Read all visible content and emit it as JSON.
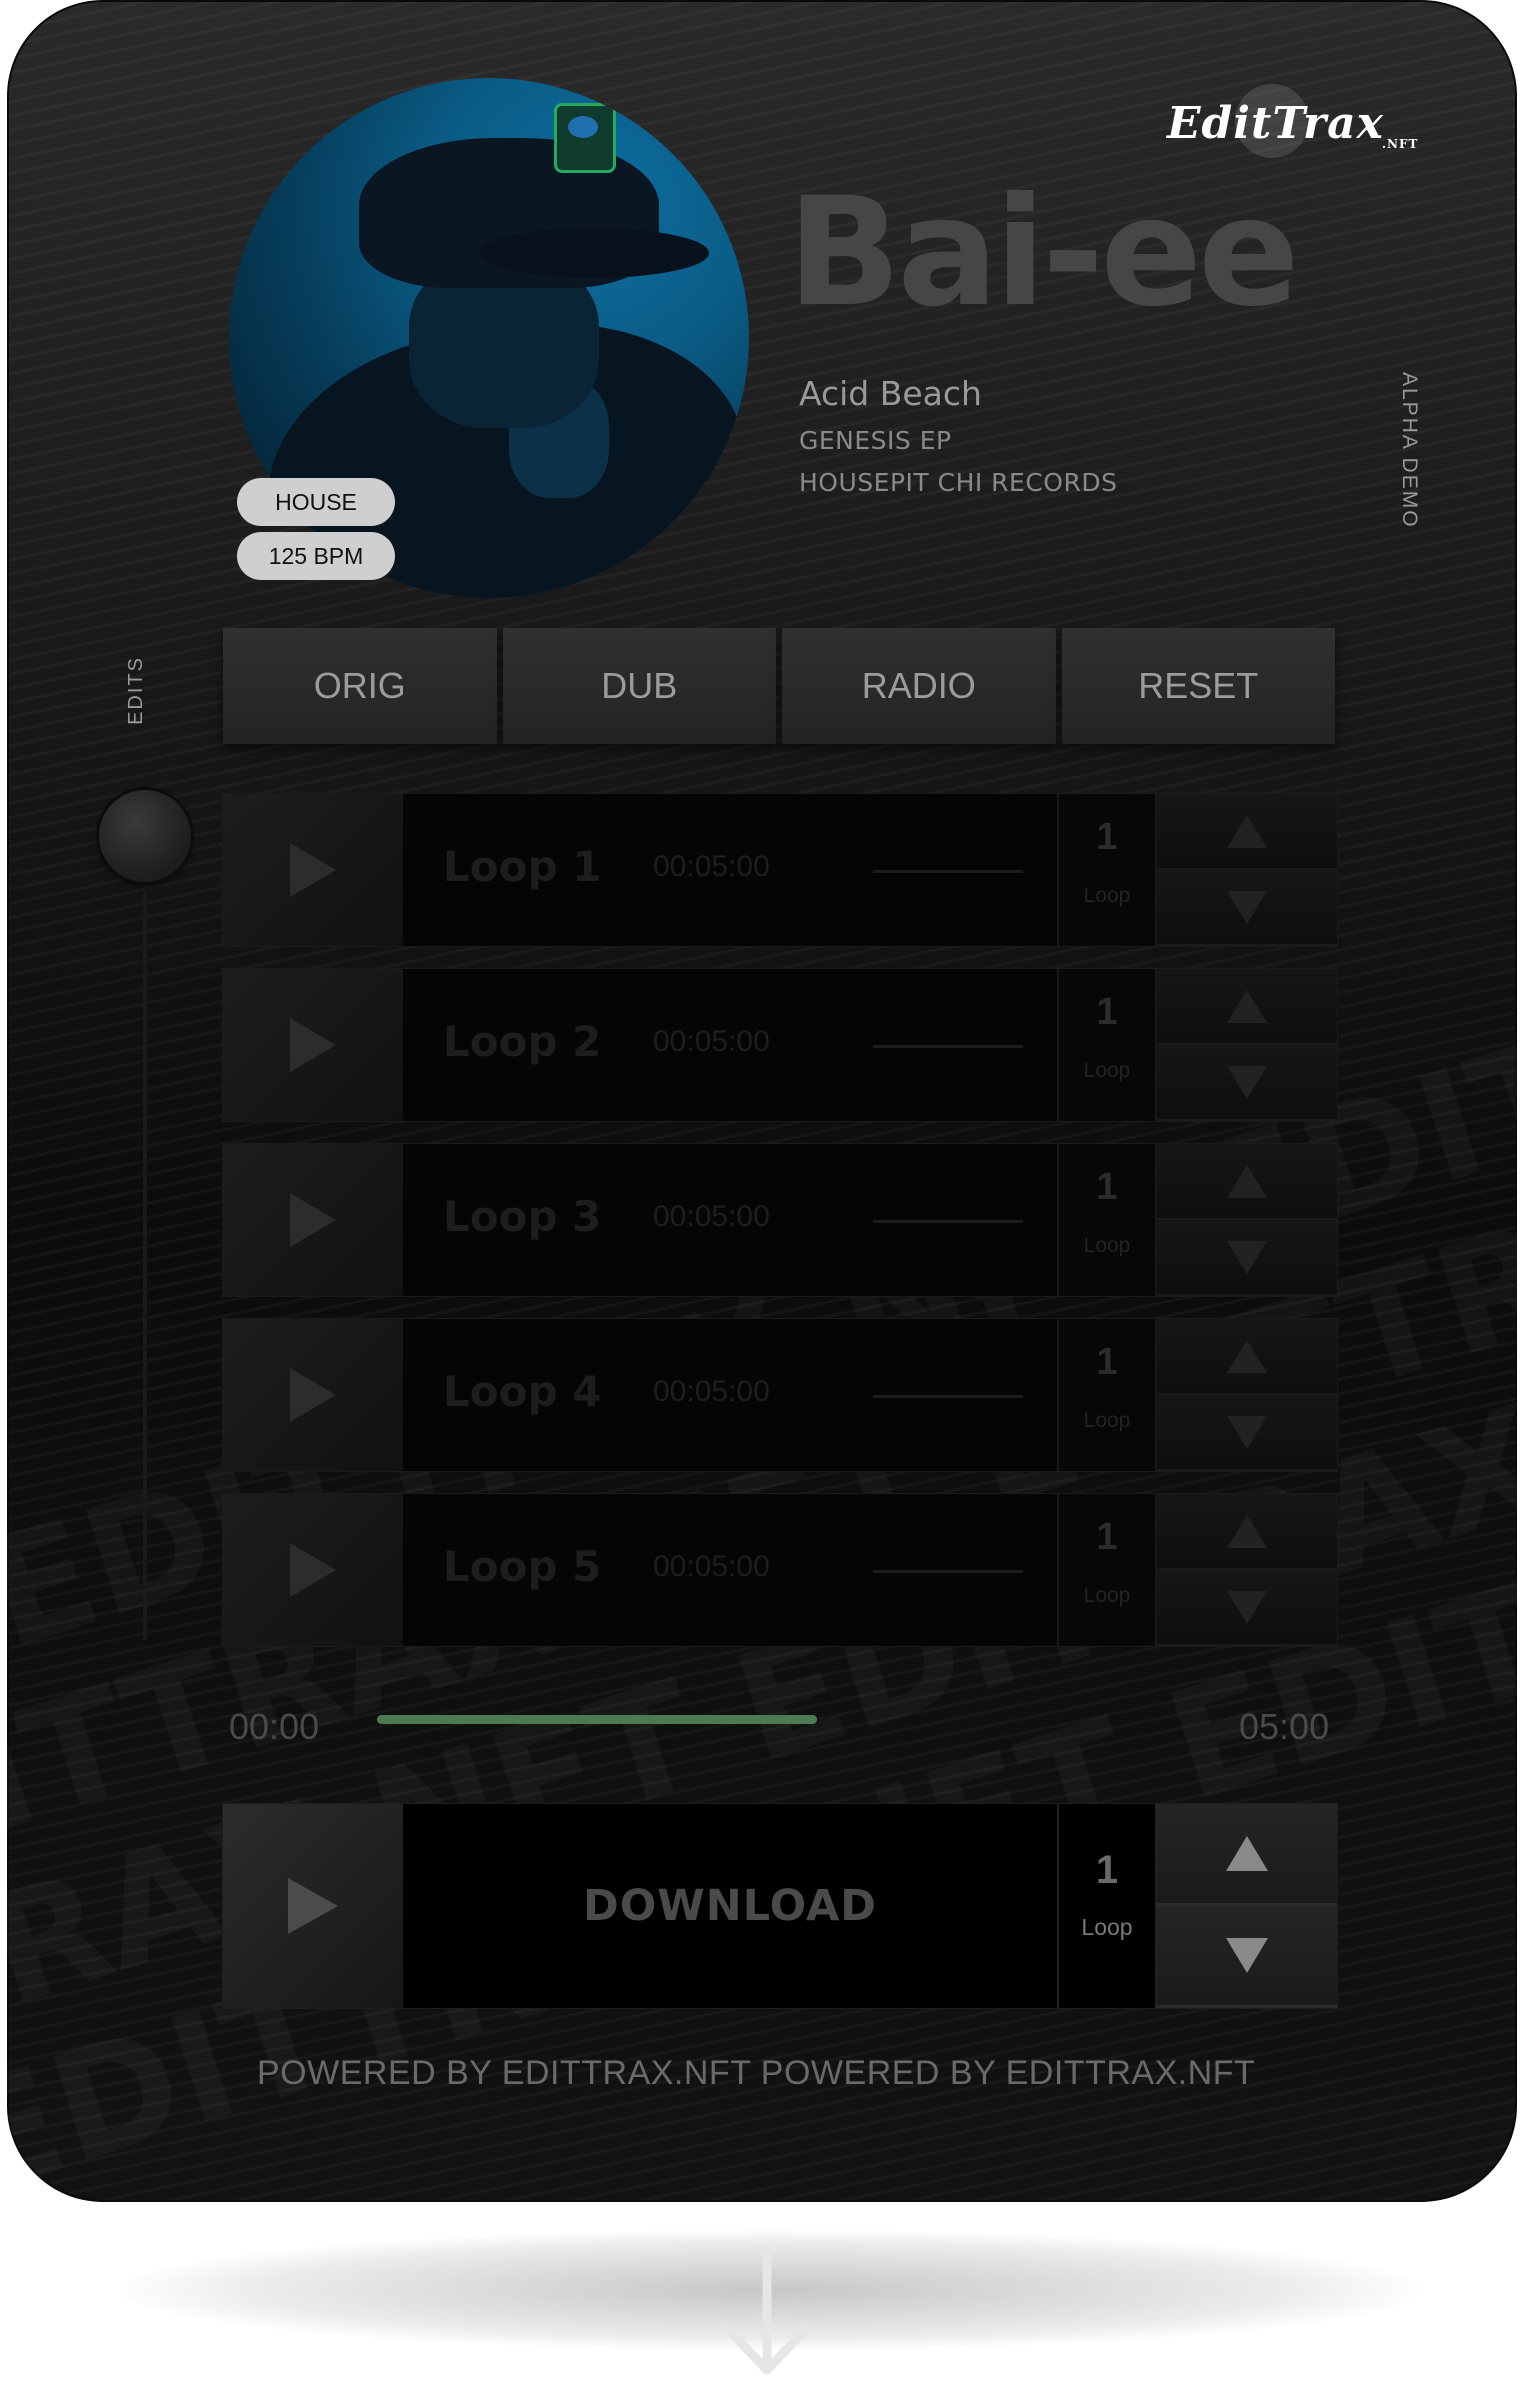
{
  "branding": {
    "logo_text": "EditTrax",
    "logo_suffix": ".NFT",
    "watermark": "EDITTRAX.NFT EDITTRAX.NFT EDITTRAX.NFT"
  },
  "track": {
    "artist": "Bai-ee",
    "title": "Acid Beach",
    "release": "GENESIS EP",
    "label": "HOUSEPIT CHI RECORDS",
    "genre": "HOUSE",
    "bpm": "125 BPM"
  },
  "side_labels": {
    "right": "ALPHA DEMO",
    "left": "EDITS"
  },
  "tabs": [
    {
      "label": "ORIG"
    },
    {
      "label": "DUB"
    },
    {
      "label": "RADIO"
    },
    {
      "label": "RESET"
    }
  ],
  "loops": [
    {
      "name": "Loop 1",
      "time": "00:05:00",
      "count": "1",
      "unit": "Loop"
    },
    {
      "name": "Loop 2",
      "time": "00:05:00",
      "count": "1",
      "unit": "Loop"
    },
    {
      "name": "Loop 3",
      "time": "00:05:00",
      "count": "1",
      "unit": "Loop"
    },
    {
      "name": "Loop 4",
      "time": "00:05:00",
      "count": "1",
      "unit": "Loop"
    },
    {
      "name": "Loop 5",
      "time": "00:05:00",
      "count": "1",
      "unit": "Loop"
    }
  ],
  "player": {
    "current": "00:00",
    "total": "05:00",
    "progress": 1.0
  },
  "download": {
    "label": "DOWNLOAD",
    "count": "1",
    "unit": "Loop"
  },
  "footer": {
    "text": "POWERED BY EDITTRAX.NFT POWERED BY EDITTRAX.NFT"
  },
  "colors": {
    "accent_progress": "#4d7a50",
    "avatar_tint": "#0a5c86",
    "badge_bg": "#cfcfcf"
  },
  "icons": {
    "play": "play-icon",
    "up": "arrow-up-icon",
    "down": "arrow-down-icon",
    "scroll": "arrow-down-icon"
  }
}
